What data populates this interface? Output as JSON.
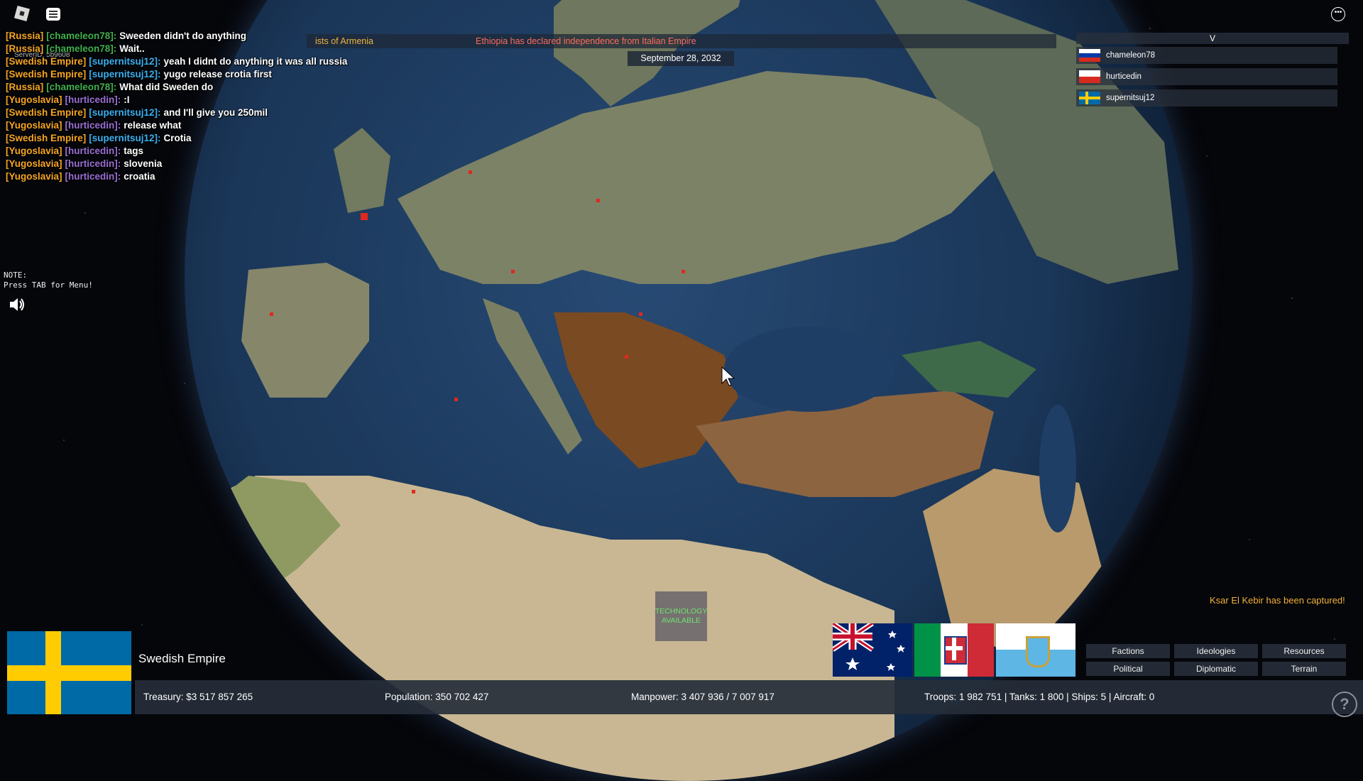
{
  "chat": {
    "server_label": "ServerID: 5b9608",
    "messages": [
      {
        "country": "[Russia]",
        "user": "[chameleon78]:",
        "text": "Sweeden didn't do anything",
        "type": "rus"
      },
      {
        "country": "[Russia]",
        "user": "[chameleon78]:",
        "text": "Wait..",
        "type": "rus"
      },
      {
        "country": "[Swedish Empire]",
        "user": "[supernitsuj12]:",
        "text": "yeah I didnt do anything it was all russia",
        "type": "swe"
      },
      {
        "country": "[Swedish Empire]",
        "user": "[supernitsuj12]:",
        "text": "yugo release crotia first",
        "type": "swe"
      },
      {
        "country": "[Russia]",
        "user": "[chameleon78]:",
        "text": "What did Sweden do",
        "type": "rus"
      },
      {
        "country": "[Yugoslavia]",
        "user": "[hurticedin]:",
        "text": ":I",
        "type": "yug"
      },
      {
        "country": "[Swedish Empire]",
        "user": "[supernitsuj12]:",
        "text": "and I'll give you 250mil",
        "type": "swe"
      },
      {
        "country": "[Yugoslavia]",
        "user": "[hurticedin]:",
        "text": "release what",
        "type": "yug"
      },
      {
        "country": "[Swedish Empire]",
        "user": "[supernitsuj12]:",
        "text": "Crotia",
        "type": "swe"
      },
      {
        "country": "[Yugoslavia]",
        "user": "[hurticedin]:",
        "text": "tags",
        "type": "yug"
      },
      {
        "country": "[Yugoslavia]",
        "user": "[hurticedin]:",
        "text": "slovenia",
        "type": "yug"
      },
      {
        "country": "[Yugoslavia]",
        "user": "[hurticedin]:",
        "text": "croatia",
        "type": "yug"
      }
    ]
  },
  "note": {
    "line1": "NOTE:",
    "line2": "Press TAB for Menu!"
  },
  "news": {
    "left_text": "ists of Armenia",
    "main_text": "Ethiopia has declared independence from Italian Empire",
    "date": "September 28, 2032"
  },
  "players": {
    "header": "V",
    "list": [
      {
        "name": "chameleon78",
        "flag": "russia-flag"
      },
      {
        "name": "hurticedin",
        "flag": "yugoslavia-flag"
      },
      {
        "name": "supernitsuj12",
        "flag": "sweden-flag"
      }
    ]
  },
  "country": {
    "name": "Swedish Empire",
    "flag": "sweden-flag",
    "colors": {
      "blue": "#006aa7",
      "yellow": "#fecc00"
    }
  },
  "stats": {
    "treasury": "Treasury:  $3 517 857 265",
    "population": "Population: 350 702 427",
    "manpower": "Manpower:  3 407 936  /  7 007 917",
    "military": "Troops: 1 982 751  |  Tanks: 1 800  |  Ships: 5  |  Aircraft: 0"
  },
  "tech": {
    "label": "TECHNOLOGY AVAILABLE"
  },
  "notification": {
    "captured": "Ksar El Kebir has been captured!"
  },
  "menu_buttons": [
    "Factions",
    "Ideologies",
    "Resources",
    "Political",
    "Diplomatic",
    "Terrain"
  ],
  "bottom_flags": [
    "australia-flag",
    "italy-kingdom-flag",
    "san-marino-flag"
  ],
  "map_colors": {
    "yugoslavia": "#7a4a22",
    "turkey": "#8c6440",
    "europe_land": "#7c8266",
    "ocean": "#1f3e66",
    "africa": "#c9b793"
  }
}
